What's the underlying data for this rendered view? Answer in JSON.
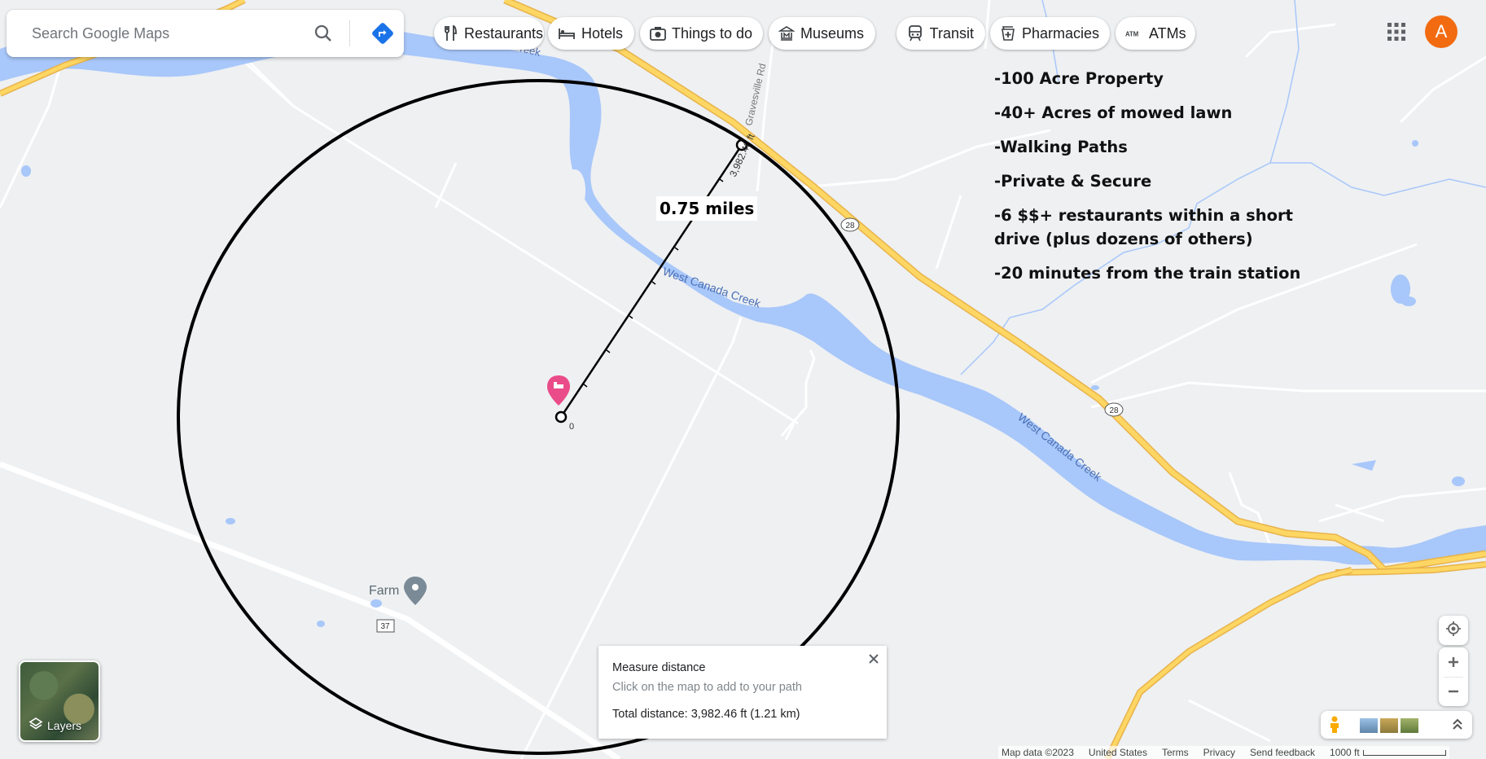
{
  "search": {
    "placeholder": "Search Google Maps",
    "icon": "search-icon",
    "directions_icon": "directions-icon"
  },
  "categories": [
    {
      "label": "Restaurants",
      "icon": "fork-knife-icon"
    },
    {
      "label": "Hotels",
      "icon": "bed-icon"
    },
    {
      "label": "Things to do",
      "icon": "camera-icon"
    },
    {
      "label": "Museums",
      "icon": "museum-icon"
    },
    {
      "label": "Transit",
      "icon": "train-icon"
    },
    {
      "label": "Pharmacies",
      "icon": "pharmacy-icon"
    },
    {
      "label": "ATMs",
      "icon": "atm-icon"
    }
  ],
  "account": {
    "initial": "A",
    "color": "#f26b10"
  },
  "notes": [
    "-100 Acre Property",
    "-40+ Acres of mowed lawn",
    "-Walking Paths",
    "-Private & Secure",
    "-6 $$+ restaurants within a short drive (plus dozens of others)",
    "-20 minutes from the train station"
  ],
  "radius_label": "0.75 miles",
  "map_labels": {
    "road_gravesville": "Gravesville Rd",
    "creek_1": "West Canada Creek",
    "creek_2": "West Canada Creek",
    "creek_top": "reek",
    "route_28_a": "28",
    "route_28_b": "28",
    "route_37": "37",
    "farm": "Farm",
    "measure_along": "3,982.46 ft",
    "measure_start": "0"
  },
  "measure": {
    "title": "Measure distance",
    "hint": "Click on the map to add to your path",
    "total": "Total distance: 3,982.46 ft (1.21 km)"
  },
  "layers": {
    "label": "Layers"
  },
  "footer": {
    "map_data": "Map data ©2023",
    "country": "United States",
    "terms": "Terms",
    "privacy": "Privacy",
    "feedback": "Send feedback",
    "scale": "1000 ft"
  },
  "colors": {
    "water": "#a8c7fa",
    "highway": "#fdd663",
    "highway_edge": "#e8b34b",
    "land": "#eef0f2",
    "road": "#ffffff",
    "pin": "#ea4c89"
  }
}
